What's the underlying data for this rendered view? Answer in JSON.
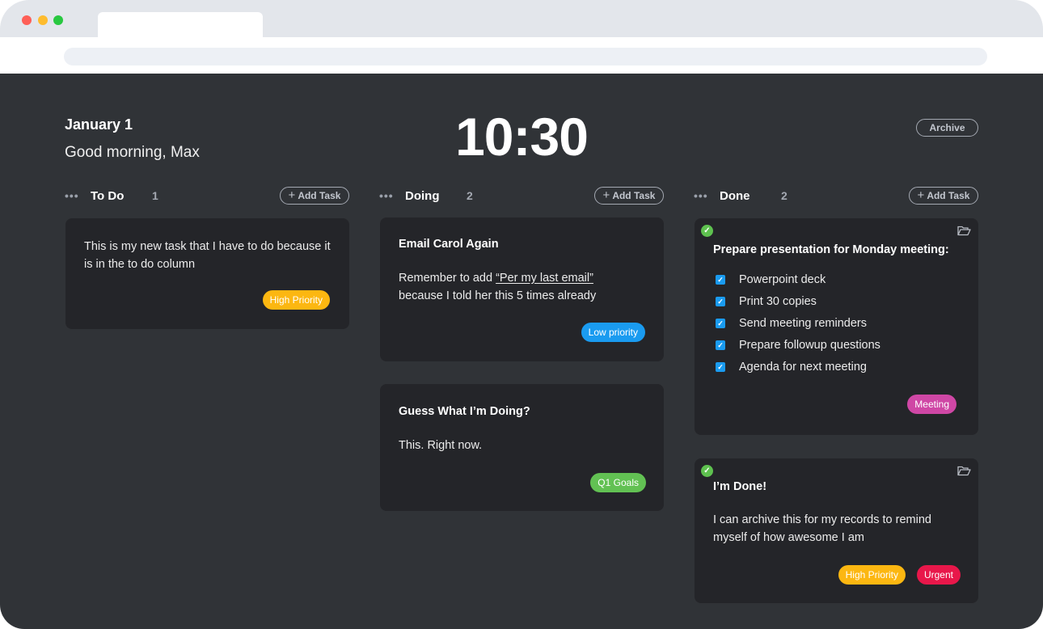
{
  "header": {
    "date": "January 1",
    "greeting": "Good morning, Max",
    "time": "10:30",
    "archive_label": "Archive"
  },
  "colors": {
    "background": "#303337",
    "card": "#242529",
    "high_priority": "#fcb711",
    "low_priority": "#1a9bf0",
    "q1_goals": "#62c153",
    "meeting": "#cf47a5",
    "urgent": "#e8174a",
    "done_check": "#5ec14f"
  },
  "columns": [
    {
      "title": "To Do",
      "count": "1",
      "menu_icon": "ellipsis-icon",
      "add_label": "Add Task",
      "cards": [
        {
          "text": "This is my new task that I have to do because it is in the to do column",
          "tags": [
            "High Priority"
          ]
        }
      ]
    },
    {
      "title": "Doing",
      "count": "2",
      "menu_icon": "ellipsis-icon",
      "add_label": "Add Task",
      "cards": [
        {
          "title": "Email Carol Again",
          "text_before": "Remember to add ",
          "text_link": "“Per my last email”",
          "text_after": "because I told her this 5 times already",
          "tags": [
            "Low priority"
          ]
        },
        {
          "title": "Guess What I’m Doing?",
          "text": "This. Right now.",
          "tags": [
            "Q1 Goals"
          ]
        }
      ]
    },
    {
      "title": "Done",
      "count": "2",
      "menu_icon": "ellipsis-icon",
      "add_label": "Add Task",
      "cards": [
        {
          "title": "Prepare presentation for Monday meeting:",
          "checklist": [
            "Powerpoint deck",
            "Print 30 copies",
            "Send meeting reminders",
            "Prepare followup questions",
            "Agenda for next meeting"
          ],
          "tags": [
            "Meeting"
          ]
        },
        {
          "title": "I’m Done!",
          "text": "I can archive this for my records to remind myself of how awesome I am",
          "tags": [
            "High Priority",
            "Urgent"
          ]
        }
      ]
    }
  ]
}
